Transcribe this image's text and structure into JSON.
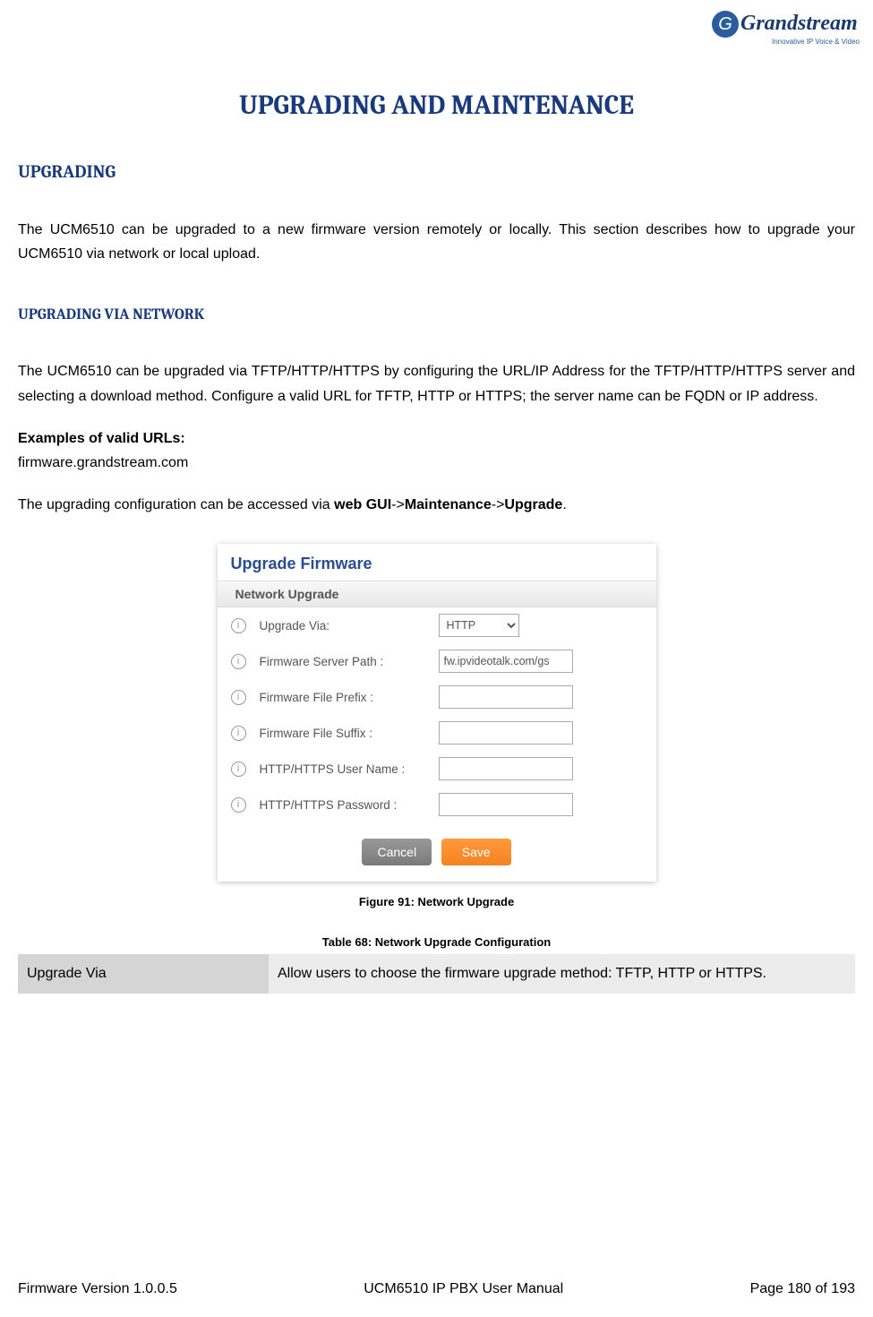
{
  "logo": {
    "brand": "Grandstream",
    "tagline": "Innovative IP Voice & Video"
  },
  "main_title": "UPGRADING AND MAINTENANCE",
  "section1": {
    "title": "UPGRADING",
    "para1": "The UCM6510 can be upgraded to a new firmware version remotely or locally. This section describes how to upgrade your UCM6510 via network or local upload."
  },
  "section2": {
    "title": "UPGRADING VIA NETWORK",
    "para1": "The UCM6510 can be upgraded via TFTP/HTTP/HTTPS by configuring the URL/IP Address for the TFTP/HTTP/HTTPS server and selecting a download method. Configure a valid URL for TFTP, HTTP or HTTPS; the server name can be FQDN or IP address.",
    "examples_label": "Examples of valid URLs:",
    "examples_url": "firmware.grandstream.com",
    "para2_pre": "The upgrading configuration can be accessed via ",
    "para2_b1": "web GUI",
    "para2_sep1": "->",
    "para2_b2": "Maintenance",
    "para2_sep2": "->",
    "para2_b3": "Upgrade",
    "para2_end": "."
  },
  "figure": {
    "title": "Upgrade Firmware",
    "subtitle": "Network Upgrade",
    "rows": [
      {
        "label": "Upgrade Via:",
        "type": "select",
        "value": "HTTP"
      },
      {
        "label": "Firmware Server Path :",
        "type": "text",
        "value": "fw.ipvideotalk.com/gs"
      },
      {
        "label": "Firmware File Prefix :",
        "type": "text",
        "value": ""
      },
      {
        "label": "Firmware File Suffix :",
        "type": "text",
        "value": ""
      },
      {
        "label": "HTTP/HTTPS User Name :",
        "type": "text",
        "value": ""
      },
      {
        "label": "HTTP/HTTPS Password :",
        "type": "text",
        "value": ""
      }
    ],
    "cancel": "Cancel",
    "save": "Save",
    "caption": "Figure 91: Network Upgrade"
  },
  "table": {
    "caption": "Table 68: Network Upgrade Configuration",
    "row1_label": "Upgrade Via",
    "row1_desc": "Allow users to choose the firmware upgrade method: TFTP, HTTP or HTTPS."
  },
  "footer": {
    "left": "Firmware Version 1.0.0.5",
    "center": "UCM6510 IP PBX User Manual",
    "right": "Page 180 of 193"
  }
}
